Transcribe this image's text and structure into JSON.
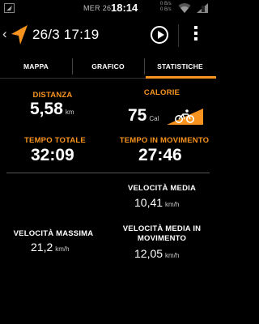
{
  "status_bar": {
    "date": "MER 26",
    "time": "18:14",
    "data_top": "0 B/s",
    "data_bottom": "0 B/s",
    "icons": [
      "navigation-icon",
      "data-traffic-icon",
      "wifi-icon",
      "battery-icon"
    ]
  },
  "action_bar": {
    "back_icon": "chevron-left",
    "title": "26/3 17:19",
    "icons": [
      "app-logo-arrow-icon",
      "play-icon",
      "overflow-menu-icon"
    ]
  },
  "tabs": [
    {
      "label": "MAPPA",
      "selected": false
    },
    {
      "label": "GRAFICO",
      "selected": false
    },
    {
      "label": "STATISTICHE",
      "selected": true
    }
  ],
  "stats": {
    "distance": {
      "label": "DISTANZA",
      "value": "5,58",
      "unit": "km"
    },
    "calories": {
      "label": "CALORIE",
      "value": "75",
      "unit": "Cal",
      "activity_icon": "bicycle-icon"
    },
    "total_time": {
      "label": "TEMPO TOTALE",
      "value": "32:09"
    },
    "moving_time": {
      "label": "TEMPO IN MOVIMENTO",
      "value": "27:46"
    },
    "avg_speed": {
      "label": "VELOCITÀ MEDIA",
      "value": "10,41",
      "unit": "km/h"
    },
    "max_speed": {
      "label": "VELOCITÀ MASSIMA",
      "value": "21,2",
      "unit": "km/h"
    },
    "avg_moving_speed": {
      "label_line1": "VELOCITÀ MEDIA IN",
      "label_line2": "MOVIMENTO",
      "value": "12,05",
      "unit": "km/h"
    }
  },
  "colors": {
    "accent": "#f7931e",
    "background": "#000000",
    "text": "#ffffff"
  }
}
